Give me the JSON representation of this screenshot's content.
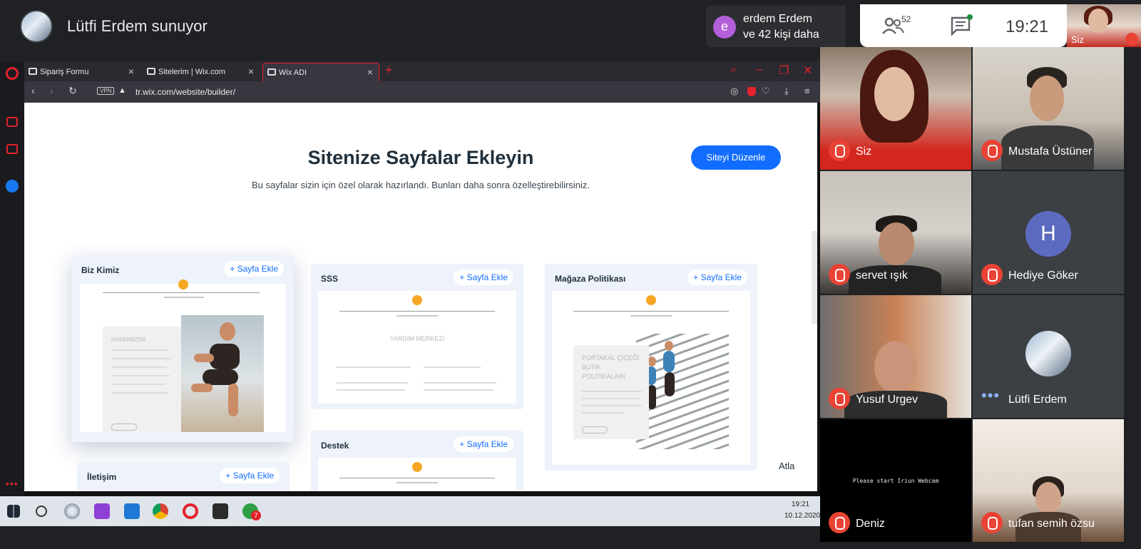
{
  "meet": {
    "presenter_title": "Lütfi Erdem sunuyor",
    "join_initial": "e",
    "join_line1": "erdem Erdem",
    "join_line2": "ve 42 kişi daha",
    "people_count": "52",
    "clock": "19:21",
    "self_label": "Siz"
  },
  "browser": {
    "tabs": [
      {
        "label": "Sipariş Formu",
        "close": "×"
      },
      {
        "label": "Sitelerim | Wix.com",
        "close": "×"
      },
      {
        "label": "Wix ADI",
        "close": "×"
      }
    ],
    "tab_add": "+",
    "vpn": "VPN",
    "url": "tr.wix.com/website/builder/"
  },
  "wix": {
    "title": "Sitenize Sayfalar Ekleyin",
    "subtitle": "Bu sayfalar sizin için özel olarak hazırlandı. Bunları daha sonra özelleştirebilirsiniz.",
    "edit_button": "Siteyi Düzenle",
    "skip": "Atla",
    "add_label": "+ Sayfa Ekle",
    "cards": [
      {
        "name": "Biz Kimiz",
        "preview_heading": "HAKKIMIZDA"
      },
      {
        "name": "SSS",
        "preview_heading": "YARDIM MERKEZİ"
      },
      {
        "name": "Mağaza Politikası",
        "preview_heading": "PORTAKAL ÇİÇEĞİ BUTİK POLİTİKALARI"
      },
      {
        "name": "Destek"
      },
      {
        "name": "İletişim"
      }
    ]
  },
  "taskbar": {
    "time": "19:21",
    "date": "10.12.2020",
    "opera_badge": "7"
  },
  "participants": [
    {
      "name": "Siz",
      "muted": true
    },
    {
      "name": "Mustafa Üstüner",
      "muted": true
    },
    {
      "name": "servet ışık",
      "muted": true
    },
    {
      "name": "Hediye Göker",
      "muted": true,
      "initial": "H"
    },
    {
      "name": "Yusuf Urgev",
      "muted": true
    },
    {
      "name": "Lütfi Erdem",
      "muted": false
    },
    {
      "name": "Deniz",
      "muted": true,
      "status": "Please start Iriun Webcam"
    },
    {
      "name": "tufan semih özsu",
      "muted": true
    }
  ],
  "colors": {
    "wix_blue": "#116dff",
    "opera_red": "#e3222b",
    "mute_red": "#ea4335",
    "meet_bg": "#202124"
  }
}
